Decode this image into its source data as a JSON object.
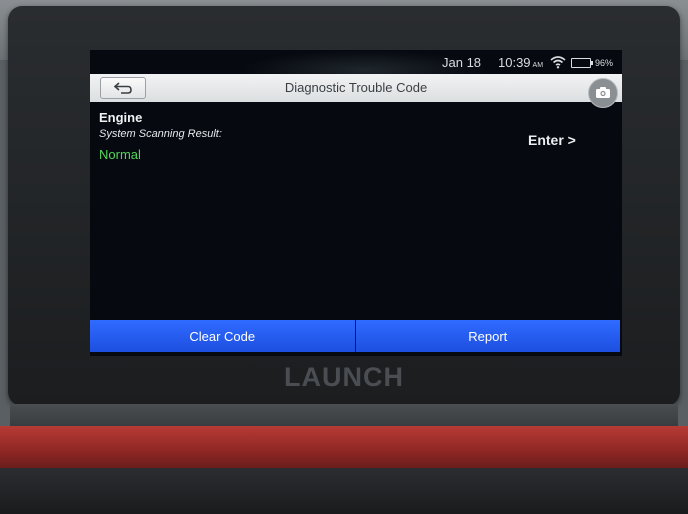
{
  "status_bar": {
    "date": "Jan 18",
    "time": "10:39",
    "ampm": "AM",
    "battery": "96%"
  },
  "title_bar": {
    "title": "Diagnostic Trouble Code"
  },
  "result": {
    "system": "Engine",
    "label": "System Scanning Result:",
    "status": "Normal",
    "enter_label": "Enter >"
  },
  "actions": {
    "clear_code": "Clear Code",
    "report": "Report"
  },
  "brand": "LAUNCH",
  "colors": {
    "accent_blue": "#2f6bff",
    "status_green": "#52d65a"
  },
  "icons": {
    "back": "back-arrow-icon",
    "wifi": "wifi-icon",
    "battery": "battery-icon",
    "camera": "camera-icon"
  }
}
